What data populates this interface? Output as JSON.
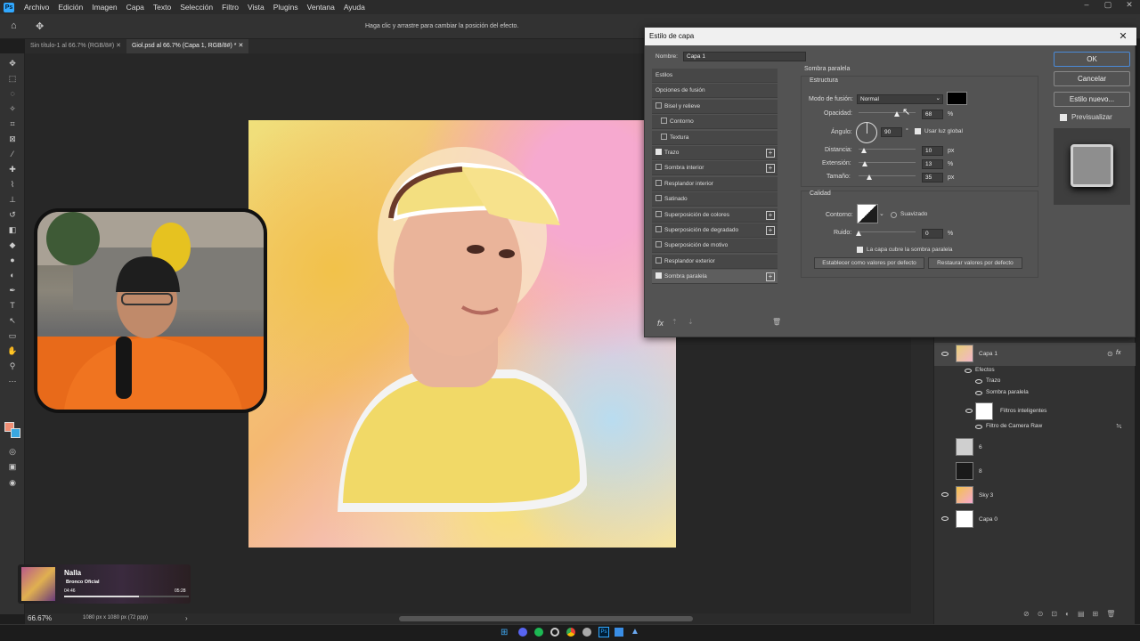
{
  "menu": {
    "logo": "Ps",
    "items": [
      "Archivo",
      "Edición",
      "Imagen",
      "Capa",
      "Texto",
      "Selección",
      "Filtro",
      "Vista",
      "Plugins",
      "Ventana",
      "Ayuda"
    ]
  },
  "options": {
    "hint": "Haga clic y arrastre para cambiar la posición del efecto."
  },
  "tabs": [
    "Sin título-1 al 66.7% (RGB/8#)",
    "Giol.psd al 66.7% (Capa 1, RGB/8#) *"
  ],
  "status": {
    "zoom": "66.67%",
    "doc": "1080 px x 1080 px (72 ppp)"
  },
  "music": {
    "title": "Nalla",
    "artist": "Bronco Oficial",
    "elapsed": "04:46",
    "total": "05:28",
    "progress": 0.6
  },
  "dialog": {
    "title": "Estilo de capa",
    "name_label": "Nombre:",
    "name_value": "Capa 1",
    "styles": [
      {
        "label": "Estilos",
        "type": "header"
      },
      {
        "label": "Opciones de fusión",
        "type": "header"
      },
      {
        "label": "Bisel y relieve",
        "checked": false
      },
      {
        "label": "Contorno",
        "checked": false,
        "indent": true
      },
      {
        "label": "Textura",
        "checked": false,
        "indent": true
      },
      {
        "label": "Trazo",
        "checked": true,
        "plus": true
      },
      {
        "label": "Sombra interior",
        "checked": false,
        "plus": true
      },
      {
        "label": "Resplandor interior",
        "checked": false
      },
      {
        "label": "Satinado",
        "checked": false
      },
      {
        "label": "Superposición de colores",
        "checked": false,
        "plus": true
      },
      {
        "label": "Superposición de degradado",
        "checked": false,
        "plus": true
      },
      {
        "label": "Superposición de motivo",
        "checked": false
      },
      {
        "label": "Resplandor exterior",
        "checked": false
      },
      {
        "label": "Sombra paralela",
        "checked": true,
        "plus": true,
        "selected": true
      }
    ],
    "section_title": "Sombra paralela",
    "structure_title": "Estructura",
    "blend_label": "Modo de fusión:",
    "blend_value": "Normal",
    "blend_color": "#000000",
    "opacity_label": "Opacidad:",
    "opacity_value": "68",
    "opacity_unit": "%",
    "angle_label": "Ángulo:",
    "angle_value": "90",
    "angle_unit": "°",
    "global_light_label": "Usar luz global",
    "distance_label": "Distancia:",
    "distance_value": "10",
    "distance_unit": "px",
    "spread_label": "Extensión:",
    "spread_value": "13",
    "spread_unit": "%",
    "size_label": "Tamaño:",
    "size_value": "35",
    "size_unit": "px",
    "quality_title": "Calidad",
    "contour_label": "Contorno:",
    "antialias_label": "Suavizado",
    "noise_label": "Ruido:",
    "noise_value": "0",
    "noise_unit": "%",
    "knockout_label": "La capa cubre la sombra paralela",
    "make_default": "Establecer como valores por defecto",
    "reset_default": "Restaurar valores por defecto",
    "ok": "OK",
    "cancel": "Cancelar",
    "new_style": "Estilo nuevo...",
    "preview_label": "Previsualizar",
    "fx": "fx"
  },
  "layers": {
    "items": [
      {
        "name": "Capa 1",
        "fx": "fx"
      },
      {
        "name": "Efectos"
      },
      {
        "name": "Trazo"
      },
      {
        "name": "Sombra paralela"
      },
      {
        "name": "Filtros inteligentes"
      },
      {
        "name": "Filtro de Camera Raw"
      },
      {
        "name": "6"
      },
      {
        "name": "8"
      },
      {
        "name": "Sky 3"
      },
      {
        "name": "Capa 0"
      }
    ]
  }
}
